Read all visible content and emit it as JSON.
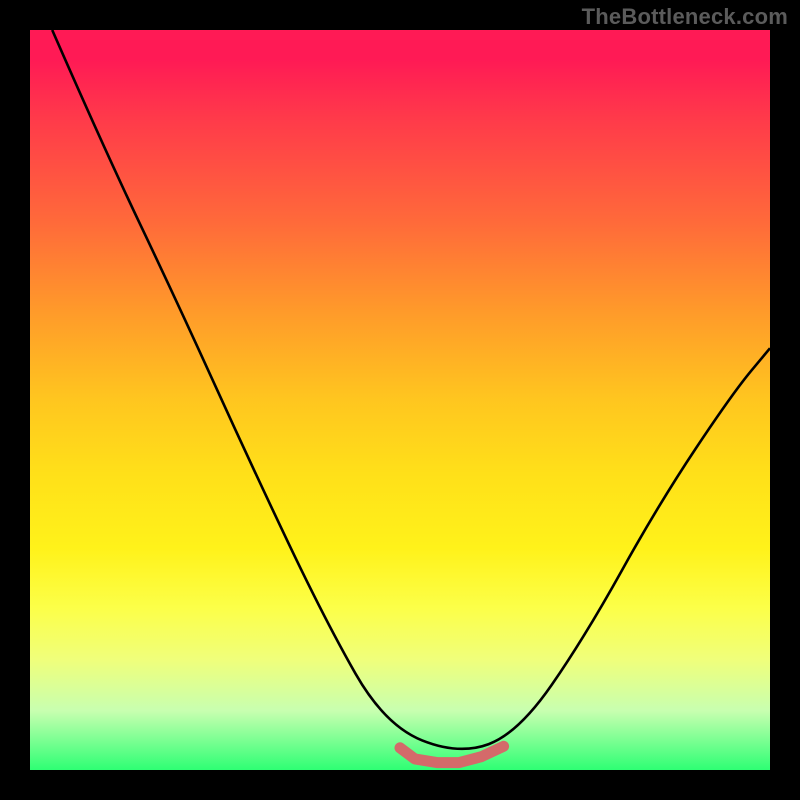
{
  "watermark": "TheBottleneck.com",
  "chart_data": {
    "type": "line",
    "title": "",
    "xlabel": "",
    "ylabel": "",
    "xlim": [
      0,
      1
    ],
    "ylim": [
      0,
      1
    ],
    "series": [
      {
        "name": "bottleneck-curve",
        "color": "#000000",
        "x": [
          0.03,
          0.1,
          0.2,
          0.3,
          0.4,
          0.48,
          0.58,
          0.66,
          0.75,
          0.85,
          0.95,
          1.0
        ],
        "y": [
          1.0,
          0.84,
          0.63,
          0.41,
          0.2,
          0.06,
          0.02,
          0.05,
          0.18,
          0.36,
          0.51,
          0.57
        ]
      },
      {
        "name": "min-region-marker",
        "color": "#e07070",
        "x": [
          0.5,
          0.52,
          0.55,
          0.58,
          0.61,
          0.64
        ],
        "y": [
          0.03,
          0.015,
          0.01,
          0.01,
          0.018,
          0.032
        ]
      }
    ],
    "gradient_stops": [
      {
        "pos": 0.0,
        "color": "#ff1a55"
      },
      {
        "pos": 0.5,
        "color": "#ffe019"
      },
      {
        "pos": 0.85,
        "color": "#f0ff7a"
      },
      {
        "pos": 1.0,
        "color": "#2eff74"
      }
    ]
  }
}
